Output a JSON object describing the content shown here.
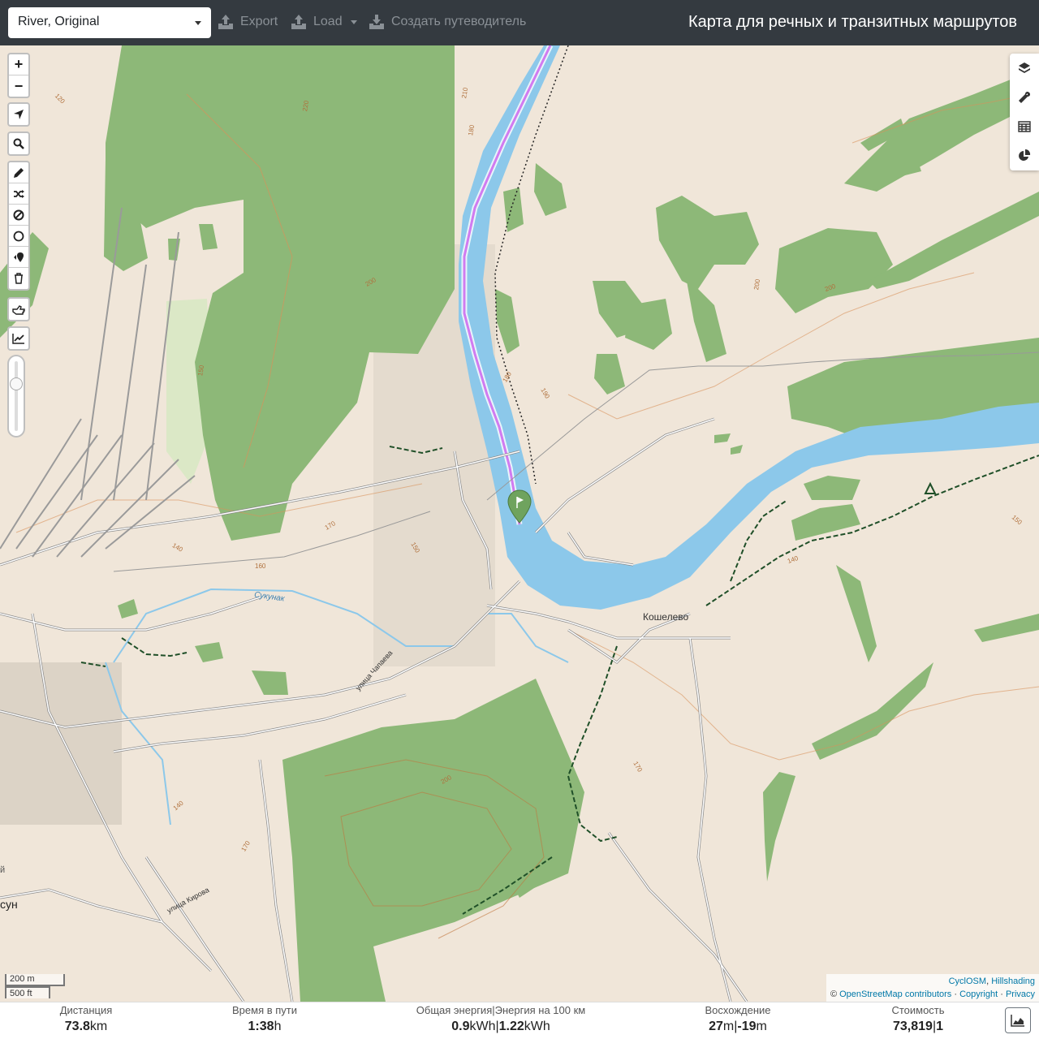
{
  "topbar": {
    "profile": "River, Original",
    "export_label": "Export",
    "load_label": "Load",
    "guide_label": "Создать путеводитель",
    "title": "Карта для речных и транзитных маршрутов"
  },
  "map": {
    "labels": {
      "village": "Кошелево",
      "street1": "улица Чапаева",
      "street2": "улица Кирова",
      "stream": "Сукунак",
      "edge_town": "сун",
      "edge_letter": "й"
    },
    "contours": [
      "120",
      "220",
      "210",
      "180",
      "200",
      "150",
      "170",
      "140",
      "160",
      "150",
      "200",
      "200",
      "190",
      "180",
      "140",
      "170",
      "200",
      "170",
      "170",
      "140",
      "150"
    ],
    "scale": {
      "metric": "200 m",
      "imperial": "500 ft"
    },
    "attribution": {
      "layer1": "CyclOSM",
      "layer2": "Hillshading",
      "copy_sym": "©",
      "osm": "OpenStreetMap contributors",
      "copyright": "Copyright",
      "privacy": "Privacy"
    },
    "colors": {
      "river": "#8cc8ea",
      "forest": "#8db878",
      "route": "#d17bf0",
      "land": "#f0e6d9"
    }
  },
  "controls": {
    "zoom_in": "+",
    "zoom_out": "−",
    "icons": [
      "locate-icon",
      "search-icon",
      "pencil-icon",
      "shuffle-icon",
      "ban-icon",
      "circle-icon",
      "poi-icon",
      "trash-icon",
      "hand-icon",
      "elevation-chart-icon"
    ],
    "right": [
      "layers-icon",
      "wrench-icon",
      "table-icon",
      "pie-chart-icon"
    ]
  },
  "stats": {
    "distance": {
      "label": "Дистанция",
      "value": "73.8",
      "unit": "km"
    },
    "time": {
      "label": "Время в пути",
      "value": "1:38",
      "unit": "h"
    },
    "energy": {
      "label": "Общая энергия",
      "sep": "|",
      "label2": "Энергия на 100 км",
      "value1": "0.9",
      "unit1": "kWh",
      "value2": "1.22",
      "unit2": "kWh"
    },
    "ascent": {
      "label": "Восхождение",
      "value1": "27",
      "unit1": "m",
      "sep": "|",
      "value2": "-19",
      "unit2": "m"
    },
    "cost": {
      "label": "Стоимость",
      "value1": "73,819",
      "sep": "|",
      "value2": "1"
    }
  }
}
